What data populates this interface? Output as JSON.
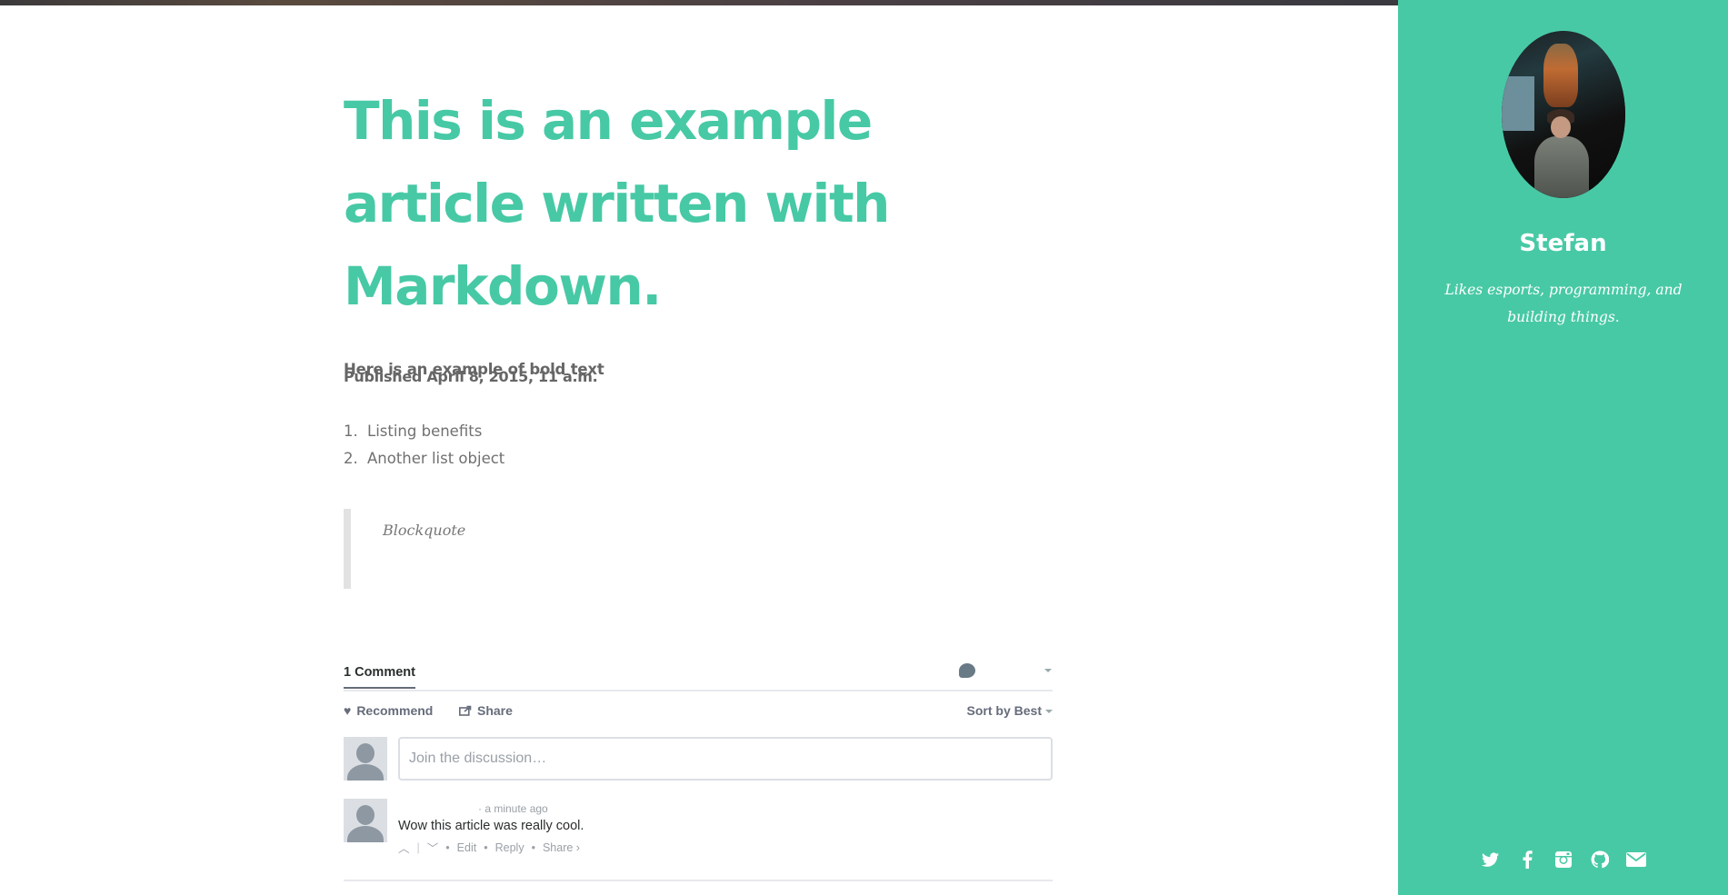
{
  "article": {
    "title": "This is an example article written with Markdown.",
    "published": "Published April 8, 2015, 11 a.m.",
    "bold_text": "Here is an example of bold text",
    "list": [
      {
        "num": "1.",
        "text": "Listing benefits"
      },
      {
        "num": "2.",
        "text": "Another list object"
      }
    ],
    "blockquote": "Blockquote"
  },
  "comments": {
    "count_label": "1 Comment",
    "recommend_label": "Recommend",
    "share_label": "Share",
    "sort_label": "Sort by Best",
    "input_placeholder": "Join the discussion…",
    "post": {
      "meta": "·  a minute ago",
      "text": "Wow this article was really cool.",
      "edit": "Edit",
      "reply": "Reply",
      "share": "Share ›"
    }
  },
  "sidebar": {
    "name": "Stefan",
    "bio": "Likes esports, programming, and building things.",
    "socials": [
      "twitter-icon",
      "facebook-icon",
      "instagram-icon",
      "github-icon",
      "email-icon"
    ]
  },
  "colors": {
    "accent": "#48c9a5",
    "text": "#666666"
  }
}
